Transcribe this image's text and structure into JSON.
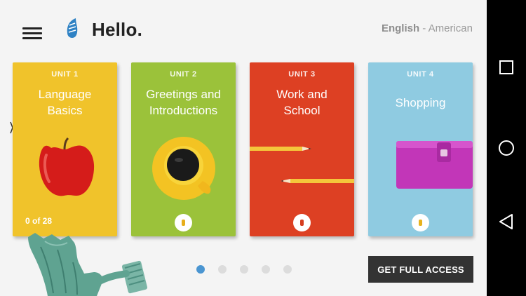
{
  "header": {
    "title": "Hello.",
    "language_main": "English",
    "language_separator": " - ",
    "language_variant": "American"
  },
  "units": [
    {
      "number_label": "UNIT 1",
      "name_line1": "Language",
      "name_line2": "Basics",
      "progress": "0 of 28",
      "color": "#f0c32b"
    },
    {
      "number_label": "UNIT 2",
      "name_line1": "Greetings and",
      "name_line2": "Introductions",
      "color": "#9bc23a"
    },
    {
      "number_label": "UNIT 3",
      "name_line1": "Work and",
      "name_line2": "School",
      "color": "#dd4023"
    },
    {
      "number_label": "UNIT 4",
      "name_line1": "Shopping",
      "color": "#8fcbe1"
    }
  ],
  "pagination": {
    "pages": 5,
    "active_index": 0
  },
  "cta": {
    "label": "GET FULL ACCESS"
  },
  "colors": {
    "accent": "#4a95d1",
    "button_bg": "#333333",
    "background": "#f4f4f4"
  },
  "icons": {
    "menu": "hamburger-menu-icon",
    "logo": "feather-logo-icon",
    "lock": "lock-icon",
    "nav_recents": "square-icon",
    "nav_home": "circle-icon",
    "nav_back": "triangle-back-icon"
  }
}
